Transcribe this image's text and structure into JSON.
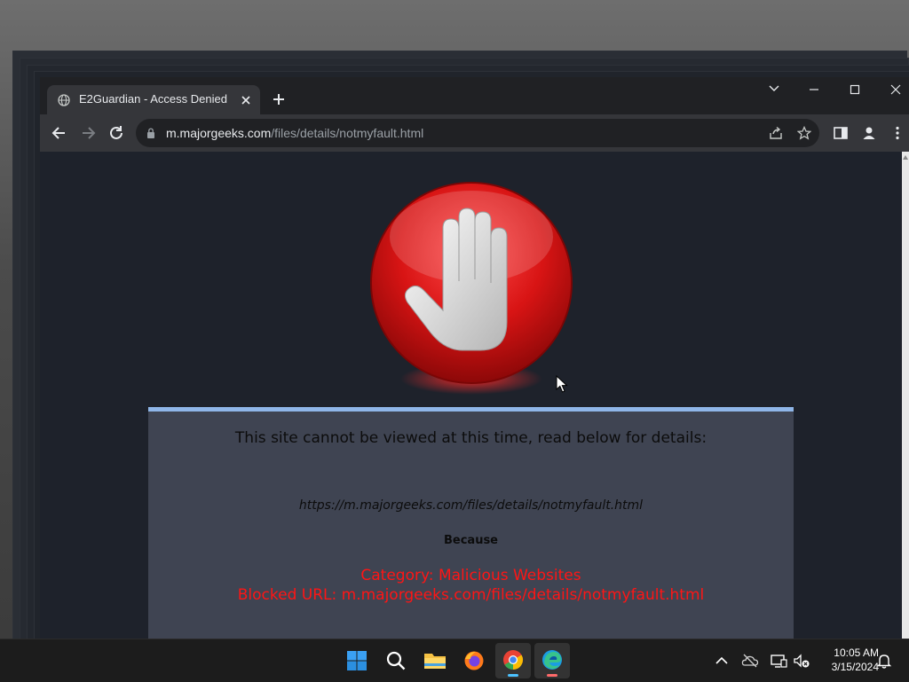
{
  "browser": {
    "tab_title": "E2Guardian - Access Denied",
    "url_host": "m.majorgeeks.com",
    "url_path": "/files/details/notmyfault.html"
  },
  "page": {
    "headline": "This site cannot be viewed at this time, read below for details:",
    "blocked_url": "https://m.majorgeeks.com/files/details/notmyfault.html",
    "because": "Because",
    "category": "Category: Malicious Websites",
    "blocked_line": "Blocked URL: m.majorgeeks.com/files/details/notmyfault.html"
  },
  "taskbar": {
    "time": "10:05 AM",
    "date": "3/15/2024",
    "apps": [
      "start-icon",
      "search-icon",
      "file-explorer-icon",
      "firefox-icon",
      "chrome-icon",
      "edge-icon"
    ]
  },
  "colors": {
    "panel_bg": "#3f4452",
    "panel_border": "#8fb6e8",
    "reason_text": "#ff1515",
    "stop_red": "#e31b1b"
  }
}
